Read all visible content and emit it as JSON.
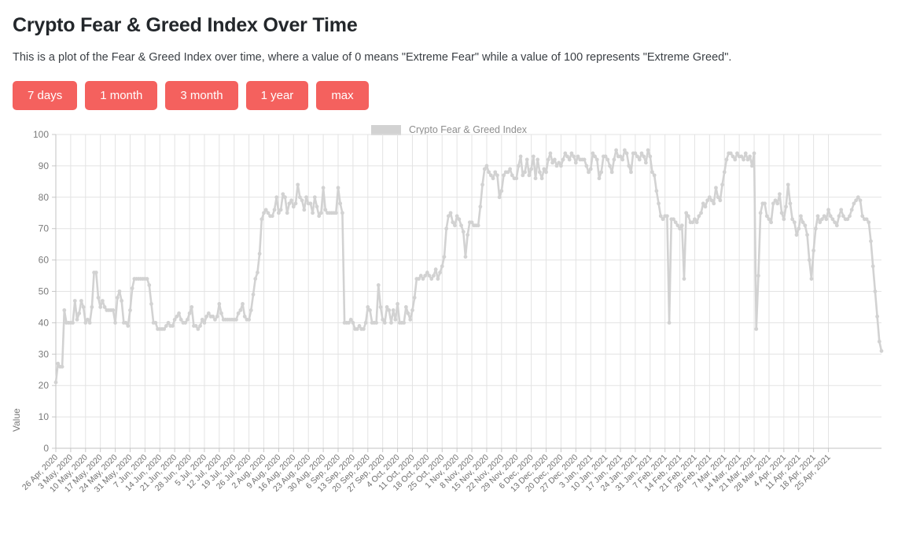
{
  "header": {
    "title": "Crypto Fear & Greed Index Over Time",
    "subtitle": "This is a plot of the Fear & Greed Index over time, where a value of 0 means \"Extreme Fear\" while a value of 100 represents \"Extreme Greed\"."
  },
  "range_buttons": [
    {
      "id": "7-days",
      "label": "7 days"
    },
    {
      "id": "1-month",
      "label": "1 month"
    },
    {
      "id": "3-month",
      "label": "3 month"
    },
    {
      "id": "1-year",
      "label": "1 year"
    },
    {
      "id": "max",
      "label": "max"
    }
  ],
  "colors": {
    "button": "#f4615e",
    "series": "#d2d2d2",
    "grid": "#e3e3e3",
    "axis_text": "#7b7b7b"
  },
  "chart_data": {
    "type": "line",
    "title": "",
    "xlabel": "",
    "ylabel": "Value",
    "ylim": [
      0,
      100
    ],
    "ytick_labels": [
      "0",
      "10",
      "20",
      "30",
      "40",
      "50",
      "60",
      "70",
      "80",
      "90",
      "100"
    ],
    "yticks": [
      0,
      10,
      20,
      30,
      40,
      50,
      60,
      70,
      80,
      90,
      100
    ],
    "grid": true,
    "legend": {
      "position": "top-center",
      "entries": [
        "Crypto Fear & Greed Index"
      ]
    },
    "markers": true,
    "x_tick_labels": [
      "26 Apr, 2020",
      "3 May, 2020",
      "10 May, 2020",
      "17 May, 2020",
      "24 May, 2020",
      "31 May, 2020",
      "7 Jun, 2020",
      "14 Jun, 2020",
      "21 Jun, 2020",
      "28 Jun, 2020",
      "5 Jul, 2020",
      "12 Jul, 2020",
      "19 Jul, 2020",
      "26 Jul, 2020",
      "2 Aug, 2020",
      "9 Aug, 2020",
      "16 Aug, 2020",
      "23 Aug, 2020",
      "30 Aug, 2020",
      "6 Sep, 2020",
      "13 Sep, 2020",
      "20 Sep, 2020",
      "27 Sep, 2020",
      "4 Oct, 2020",
      "11 Oct, 2020",
      "18 Oct, 2020",
      "25 Oct, 2020",
      "1 Nov, 2020",
      "8 Nov, 2020",
      "15 Nov, 2020",
      "22 Nov, 2020",
      "29 Nov, 2020",
      "6 Dec, 2020",
      "13 Dec, 2020",
      "20 Dec, 2020",
      "27 Dec, 2020",
      "3 Jan, 2021",
      "10 Jan, 2021",
      "17 Jan, 2021",
      "24 Jan, 2021",
      "31 Jan, 2021",
      "7 Feb, 2021",
      "14 Feb, 2021",
      "21 Feb, 2021",
      "28 Feb, 2021",
      "7 Mar, 2021",
      "14 Mar, 2021",
      "21 Mar, 2021",
      "28 Mar, 2021",
      "4 Apr, 2021",
      "11 Apr, 2021",
      "18 Apr, 2021",
      "25 Apr, 2021"
    ],
    "series": [
      {
        "name": "Crypto Fear & Greed Index",
        "values": [
          21,
          27,
          26,
          26,
          44,
          40,
          40,
          40,
          40,
          47,
          41,
          43,
          47,
          45,
          40,
          41,
          40,
          45,
          56,
          56,
          48,
          45,
          47,
          45,
          44,
          44,
          44,
          44,
          40,
          48,
          50,
          47,
          40,
          40,
          39,
          44,
          51,
          54,
          54,
          54,
          54,
          54,
          54,
          54,
          52,
          46,
          40,
          40,
          38,
          38,
          38,
          38,
          39,
          40,
          39,
          39,
          41,
          42,
          43,
          41,
          40,
          40,
          41,
          43,
          45,
          39,
          39,
          38,
          39,
          41,
          40,
          42,
          43,
          42,
          42,
          41,
          42,
          46,
          43,
          41,
          41,
          41,
          41,
          41,
          41,
          41,
          43,
          44,
          46,
          42,
          41,
          41,
          44,
          49,
          54,
          56,
          62,
          73,
          75,
          76,
          75,
          74,
          74,
          76,
          80,
          75,
          76,
          81,
          80,
          75,
          78,
          79,
          77,
          78,
          84,
          80,
          79,
          76,
          80,
          78,
          78,
          75,
          80,
          77,
          74,
          75,
          83,
          76,
          75,
          75,
          75,
          75,
          75,
          83,
          78,
          75,
          40,
          40,
          40,
          41,
          40,
          38,
          38,
          39,
          38,
          38,
          40,
          45,
          44,
          40,
          40,
          40,
          52,
          45,
          41,
          40,
          45,
          44,
          40,
          44,
          41,
          46,
          40,
          40,
          40,
          45,
          43,
          41,
          44,
          48,
          54,
          54,
          55,
          54,
          55,
          56,
          55,
          54,
          55,
          57,
          54,
          56,
          58,
          61,
          70,
          74,
          75,
          72,
          71,
          74,
          73,
          71,
          69,
          61,
          68,
          72,
          72,
          71,
          71,
          71,
          77,
          84,
          89,
          90,
          88,
          87,
          86,
          88,
          87,
          80,
          82,
          87,
          88,
          88,
          89,
          87,
          86,
          86,
          90,
          93,
          87,
          88,
          92,
          87,
          89,
          93,
          86,
          92,
          88,
          86,
          89,
          88,
          92,
          94,
          91,
          92,
          90,
          91,
          90,
          92,
          94,
          93,
          92,
          94,
          93,
          91,
          93,
          92,
          92,
          92,
          90,
          88,
          89,
          94,
          93,
          92,
          86,
          88,
          93,
          93,
          92,
          90,
          88,
          92,
          95,
          93,
          93,
          92,
          95,
          94,
          90,
          88,
          94,
          94,
          93,
          92,
          94,
          93,
          91,
          95,
          93,
          88,
          87,
          82,
          78,
          74,
          73,
          74,
          74,
          40,
          73,
          73,
          72,
          71,
          70,
          71,
          54,
          75,
          74,
          72,
          72,
          73,
          72,
          74,
          75,
          78,
          77,
          79,
          80,
          79,
          78,
          83,
          80,
          79,
          84,
          88,
          92,
          94,
          94,
          93,
          92,
          94,
          93,
          93,
          92,
          94,
          92,
          93,
          90,
          94,
          38,
          55,
          75,
          78,
          78,
          74,
          73,
          72,
          78,
          79,
          78,
          81,
          75,
          73,
          77,
          84,
          78,
          73,
          72,
          68,
          70,
          74,
          72,
          71,
          68,
          60,
          54,
          63,
          70,
          74,
          72,
          73,
          74,
          73,
          76,
          74,
          73,
          72,
          71,
          74,
          76,
          74,
          73,
          73,
          74,
          76,
          78,
          79,
          80,
          79,
          74,
          73,
          73,
          72,
          66,
          58,
          50,
          42,
          34,
          31
        ]
      }
    ]
  }
}
